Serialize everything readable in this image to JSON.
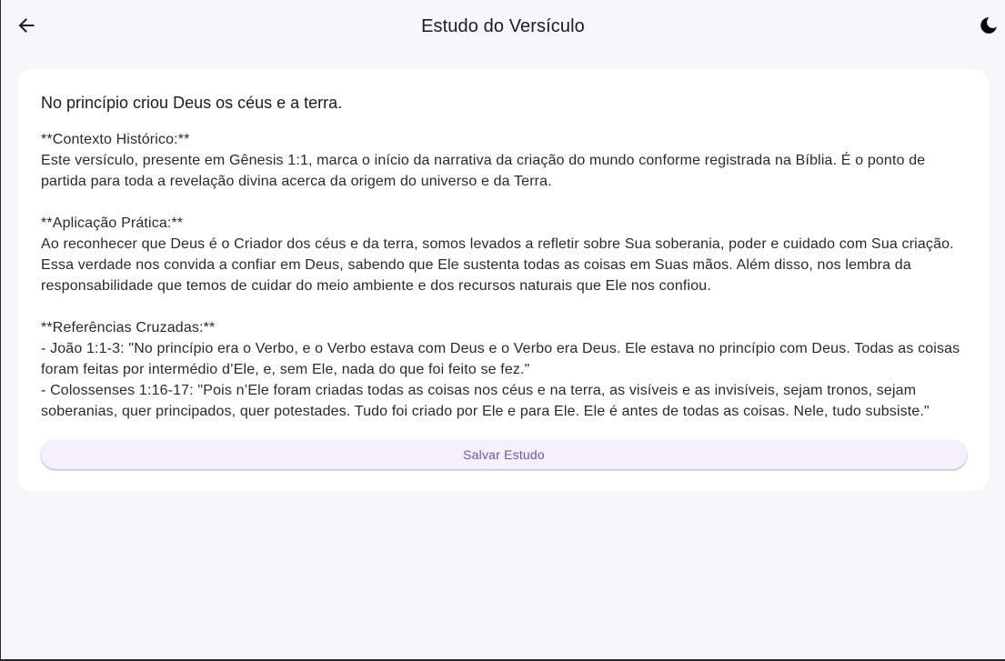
{
  "header": {
    "title": "Estudo do Versículo",
    "back_icon": "arrow-left-icon",
    "theme_icon": "moon-icon"
  },
  "card": {
    "verse": "No princípio criou Deus os céus e a terra.",
    "sections": {
      "context_heading": "**Contexto Histórico:**",
      "context_body": "Este versículo, presente em Gênesis 1:1, marca o início da narrativa da criação do mundo conforme registrada na Bíblia. É o ponto de partida para toda a revelação divina acerca da origem do universo e da Terra.",
      "application_heading": "**Aplicação Prática:**",
      "application_body": "Ao reconhecer que Deus é o Criador dos céus e da terra, somos levados a refletir sobre Sua soberania, poder e cuidado com Sua criação. Essa verdade nos convida a confiar em Deus, sabendo que Ele sustenta todas as coisas em Suas mãos. Além disso, nos lembra da responsabilidade que temos de cuidar do meio ambiente e dos recursos naturais que Ele nos confiou.",
      "references_heading": "**Referências Cruzadas:**",
      "reference_1": "- João 1:1-3: \"No princípio era o Verbo, e o Verbo estava com Deus e o Verbo era Deus. Ele estava no princípio com Deus. Todas as coisas foram feitas por intermédio d’Ele, e, sem Ele, nada do que foi feito se fez.\"",
      "reference_2": "- Colossenses 1:16-17: \"Pois n’Ele foram criadas todas as coisas nos céus e na terra, as visíveis e as invisíveis, sejam tronos, sejam soberanias, quer principados, quer potestades. Tudo foi criado por Ele e para Ele. Ele é antes de todas as coisas. Nele, tudo subsiste.\""
    },
    "save_label": "Salvar Estudo"
  },
  "colors": {
    "background": "#f6f5fa",
    "card": "#ffffff",
    "button_bg": "#f6f0fa",
    "button_text": "#6a5aa8"
  }
}
